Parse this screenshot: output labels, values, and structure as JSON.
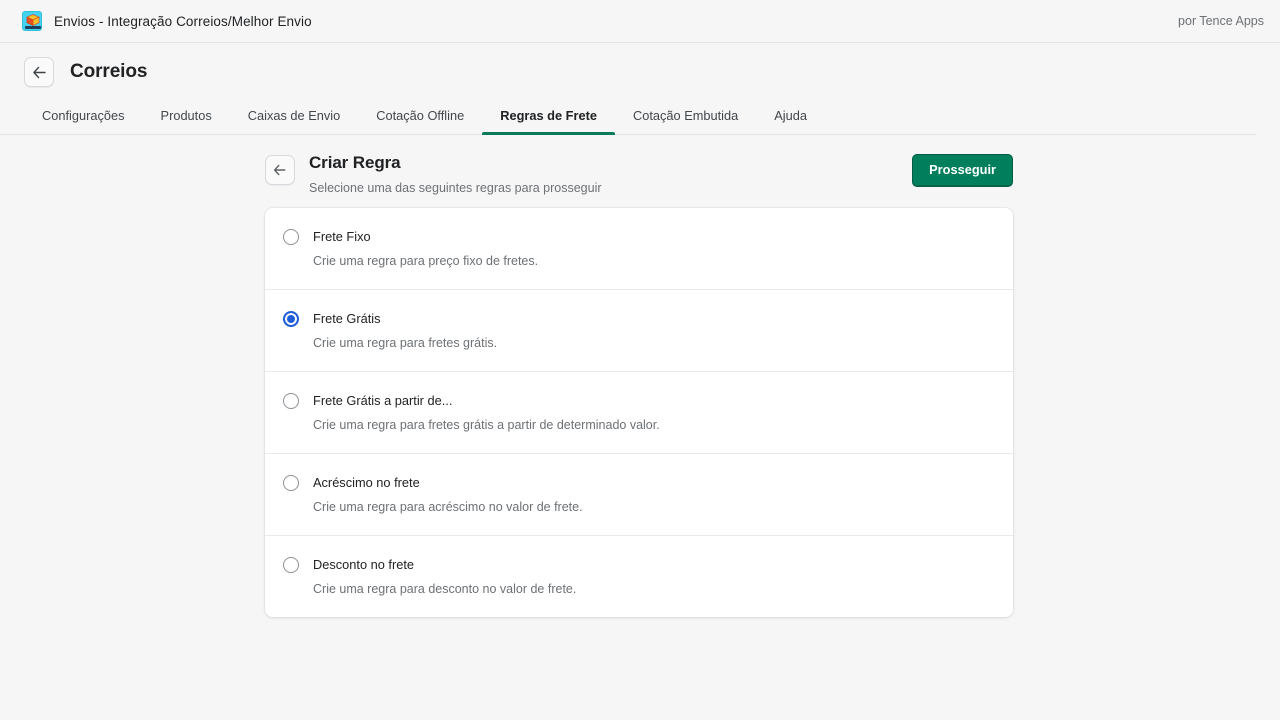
{
  "topbar": {
    "app_icon_name": "package-cube-icon",
    "title": "Envios - Integração Correios/Melhor Envio",
    "credit": "por Tence Apps"
  },
  "page_header": {
    "back_icon": "arrow-left-icon",
    "title": "Correios"
  },
  "tabs": [
    {
      "label": "Configurações",
      "active": false
    },
    {
      "label": "Produtos",
      "active": false
    },
    {
      "label": "Caixas de Envio",
      "active": false
    },
    {
      "label": "Cotação Offline",
      "active": false
    },
    {
      "label": "Regras de Frete",
      "active": true
    },
    {
      "label": "Cotação Embutida",
      "active": false
    },
    {
      "label": "Ajuda",
      "active": false
    }
  ],
  "panel": {
    "back_icon": "arrow-left-icon",
    "title": "Criar Regra",
    "subtitle": "Selecione uma das seguintes regras para prosseguir",
    "primary_button": "Prosseguir"
  },
  "options": [
    {
      "label": "Frete Fixo",
      "description": "Crie uma regra para preço fixo de fretes.",
      "selected": false
    },
    {
      "label": "Frete Grátis",
      "description": "Crie uma regra para fretes grátis.",
      "selected": true
    },
    {
      "label": "Frete Grátis a partir de...",
      "description": "Crie uma regra para fretes grátis a partir de determinado valor.",
      "selected": false
    },
    {
      "label": "Acréscimo no frete",
      "description": "Crie uma regra para acréscimo no valor de frete.",
      "selected": false
    },
    {
      "label": "Desconto no frete",
      "description": "Crie uma regra para desconto no valor de frete.",
      "selected": false
    }
  ],
  "colors": {
    "accent_green": "#017f5c",
    "tab_underline": "#0b7b5b",
    "radio_selected_blue": "#1f5ed8",
    "page_background": "#f6f6f7",
    "app_icon_background": "#43d3f0"
  }
}
